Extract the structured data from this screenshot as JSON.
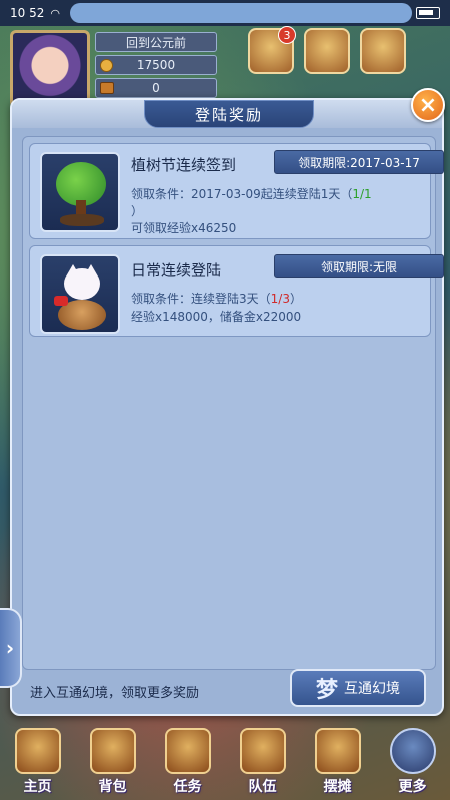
{
  "status_bar": {
    "time": "10 52"
  },
  "hud": {
    "location": "回到公元前",
    "coins": "17500",
    "chest_count": "0",
    "top_icons": [
      {
        "name": "scroll-icon",
        "badge": "3"
      },
      {
        "name": "treasure-chest-icon",
        "badge": ""
      },
      {
        "name": "gift-icon",
        "badge": ""
      }
    ]
  },
  "modal": {
    "title": "登陆奖励",
    "close_label": "×",
    "rewards": [
      {
        "name": "植树节连续签到",
        "deadline": "领取期限:2017-03-17",
        "condition_prefix": "领取条件：2017-03-09起连续登陆1天（",
        "progress": "1/1",
        "condition_suffix": "）",
        "reward": "可领取经验x46250",
        "icon": "tree-icon"
      },
      {
        "name": "日常连续登陆",
        "deadline": "领取期限:无限",
        "condition_prefix": "领取条件：连续登陆3天（",
        "progress": "1/3",
        "condition_suffix": "）",
        "reward": "经验x148000，储备金x22000",
        "icon": "lucky-cat-icon"
      }
    ],
    "footer_text": "进入互通幻境，领取更多奖励",
    "footer_button": "互通幻境",
    "footer_button_icon": "梦"
  },
  "bottom_nav": [
    {
      "label": "主页",
      "icon": "home-icon"
    },
    {
      "label": "背包",
      "icon": "bag-icon"
    },
    {
      "label": "任务",
      "icon": "quest-icon"
    },
    {
      "label": "队伍",
      "icon": "team-icon"
    },
    {
      "label": "摆摊",
      "icon": "stall-icon"
    },
    {
      "label": "更多",
      "icon": "more-icon"
    }
  ],
  "side_tab": "›"
}
